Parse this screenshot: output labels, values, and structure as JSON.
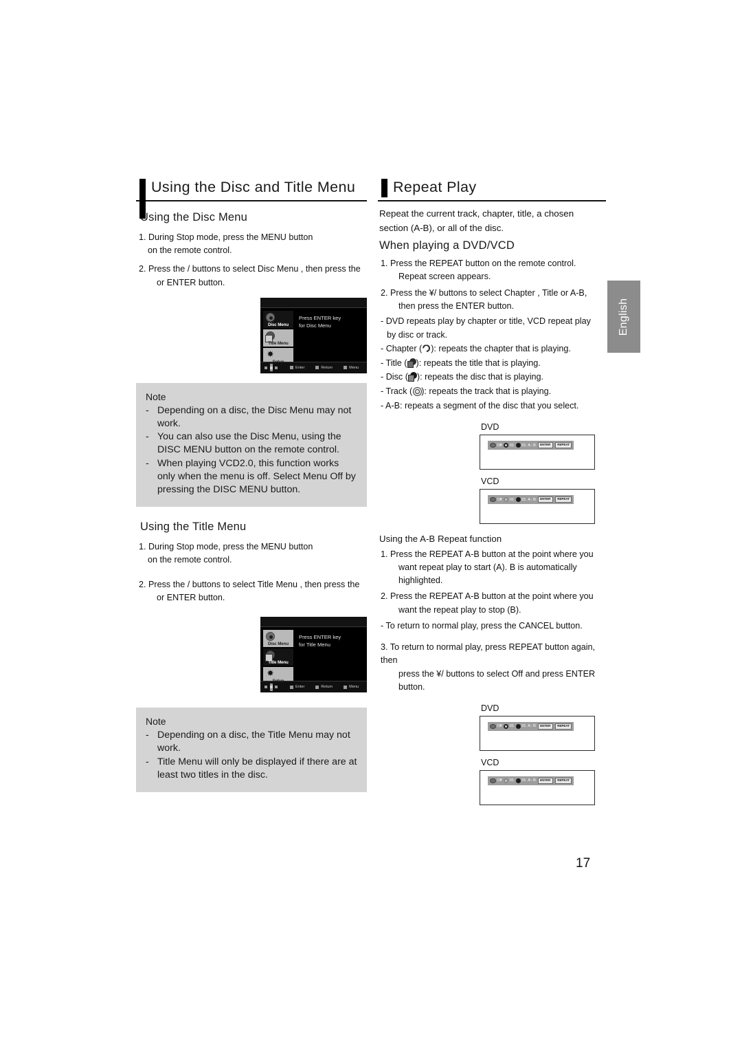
{
  "page": {
    "number": "17",
    "language_tab": "English"
  },
  "left_column": {
    "title": "Using the Disc and Title Menu",
    "disc_menu": {
      "heading": "Using the Disc Menu",
      "steps": [
        {
          "num": "1.",
          "line1": "During Stop mode, press the MENU button",
          "line2": "on the remote control."
        },
        {
          "num": "2.",
          "line1": "Press the    /    buttons to select Disc Menu , then press the",
          "line2": "or ENTER button."
        }
      ],
      "screenshot": {
        "message_line1": "Press ENTER key",
        "message_line2": "for Disc Menu",
        "tabs": [
          {
            "label": "Disc Menu",
            "icon": "disc-icon",
            "selected": true
          },
          {
            "label": "Title Menu",
            "icon": "title-icon",
            "selected": false
          },
          {
            "label": "Setup",
            "icon": "gear-icon",
            "selected": false
          }
        ],
        "footer": [
          {
            "icon": "dpad-icon",
            "label": ""
          },
          {
            "icon": "square-icon",
            "label": "Enter"
          },
          {
            "icon": "square-icon",
            "label": "Return"
          },
          {
            "icon": "square-icon",
            "label": "Menu"
          }
        ]
      },
      "note": {
        "title": "Note",
        "items": [
          "Depending on a disc, the Disc Menu may not work.",
          "You can also use the Disc Menu, using the DISC MENU button on the remote control.",
          "When playing VCD2.0, this function works only when the menu is off. Select Menu Off by pressing the DISC MENU button."
        ]
      }
    },
    "title_menu": {
      "heading": "Using the Title Menu",
      "steps": [
        {
          "num": "1.",
          "line1": "During Stop mode, press the MENU button",
          "line2": "on the remote control."
        },
        {
          "num": "2.",
          "line1": "Press the    /    buttons to select Title Menu , then press the",
          "line2": "or ENTER button."
        }
      ],
      "screenshot": {
        "message_line1": "Press ENTER key",
        "message_line2": "for Title Menu",
        "tabs": [
          {
            "label": "Disc Menu",
            "icon": "disc-icon",
            "selected": false
          },
          {
            "label": "Title Menu",
            "icon": "title-icon",
            "selected": true
          },
          {
            "label": "Setup",
            "icon": "gear-icon",
            "selected": false
          }
        ],
        "footer": [
          {
            "icon": "dpad-icon",
            "label": ""
          },
          {
            "icon": "square-icon",
            "label": "Enter"
          },
          {
            "icon": "square-icon",
            "label": "Return"
          },
          {
            "icon": "square-icon",
            "label": "Menu"
          }
        ]
      },
      "note": {
        "title": "Note",
        "items": [
          "Depending on a disc, the Title Menu may not work.",
          "Title Menu will only be displayed if there are at least two titles in the disc."
        ]
      }
    }
  },
  "right_column": {
    "title": "Repeat Play",
    "intro_line1": "Repeat the current track, chapter, title, a chosen",
    "intro_line2": "section (A-B), or all of the disc.",
    "dvd_vcd": {
      "heading": "When playing a DVD/VCD",
      "step1": {
        "num": "1.",
        "line1": "Press the REPEAT button on the remote control.",
        "line2": "Repeat screen appears."
      },
      "step2": {
        "num": "2.",
        "line1": "Press the  ¥/    buttons to select Chapter , Title  or A-B,",
        "line2": "then press the ENTER button."
      },
      "bullets": [
        {
          "text": "DVD repeats play by chapter or title, VCD repeat play",
          "text2": "by disc or track."
        },
        {
          "prefix": "Chapter (",
          "icon": "chapter-icon",
          "suffix": "): repeats the chapter that is playing."
        },
        {
          "prefix": "Title (",
          "icon": "title-icon",
          "suffix": "): repeats the title that is playing."
        },
        {
          "prefix": "Disc (",
          "icon": "disc-icon",
          "suffix": "): repeats the disc that is playing."
        },
        {
          "prefix": "Track (",
          "icon": "track-icon",
          "suffix": "): repeats the track that is playing."
        },
        {
          "text": "A-B: repeats a segment of the disc that you select."
        }
      ],
      "figures": [
        {
          "label": "DVD",
          "bar": {
            "off": "Off",
            "chapter": "01",
            "title": "01",
            "ab": "A - B",
            "enter_btn": "ENTER",
            "repeat_btn": "REPEAT"
          }
        },
        {
          "label": "VCD",
          "bar": {
            "off": "Off",
            "chapter": "01",
            "title": "01",
            "ab": "A - B",
            "enter_btn": "ENTER",
            "repeat_btn": "REPEAT"
          }
        }
      ]
    },
    "ab_repeat": {
      "heading": "Using the A-B Repeat function",
      "steps": [
        {
          "num": "1.",
          "line1": "Press the REPEAT A-B button at the point where you",
          "line2": "want repeat play to start (A). B is automatically highlighted."
        },
        {
          "num": "2.",
          "line1": "Press the REPEAT A-B button at the point where you",
          "line2": "want the repeat play to stop (B)."
        }
      ],
      "dash_note": "To return to normal play, press the CANCEL  button.",
      "step3": {
        "num": "3.",
        "line1": "To return to normal play, press REPEAT button again, then",
        "line2": "press the  ¥/    buttons to select Off and press ENTER",
        "line3": "button."
      },
      "figures": [
        {
          "label": "DVD",
          "bar": {
            "off": "Off",
            "chapter": "01",
            "title": "01",
            "ab": "A - B",
            "enter_btn": "ENTER",
            "repeat_btn": "REPEAT"
          }
        },
        {
          "label": "VCD",
          "bar": {
            "off": "Off",
            "chapter": "01",
            "title": "01",
            "ab": "A - B",
            "enter_btn": "ENTER",
            "repeat_btn": "REPEAT"
          }
        }
      ]
    }
  }
}
